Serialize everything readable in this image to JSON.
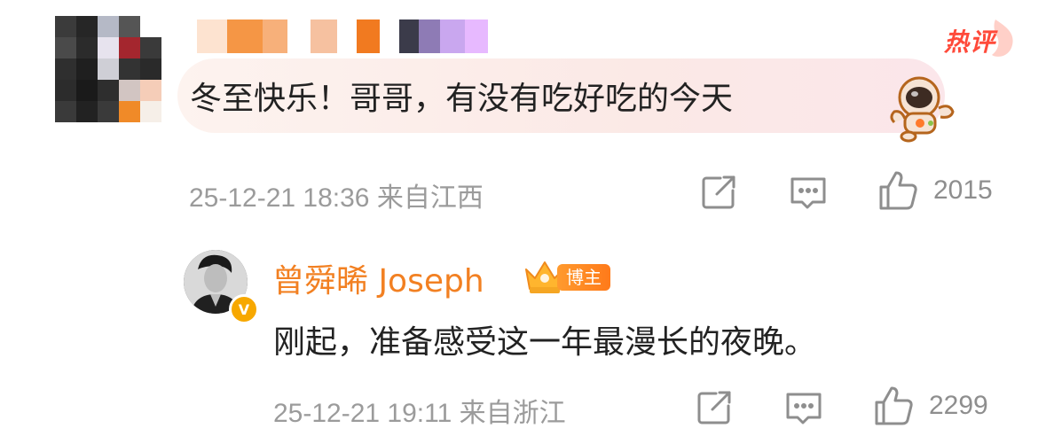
{
  "comment": {
    "hot_label": "热评",
    "text": "冬至快乐！哥哥，有没有吃好吃的今天",
    "timestamp": "25-12-21 18:36",
    "location": "来自江西",
    "like_count": "2015"
  },
  "reply": {
    "author": "曾舜晞 Joseph",
    "author_tag": "博主",
    "verified_mark": "V",
    "text": "刚起，准备感受这一年最漫长的夜晚。",
    "timestamp": "25-12-21 19:11",
    "location": "来自浙江",
    "like_count": "2299"
  },
  "colors": {
    "accent_orange": "#f28022",
    "hot_red": "#ff4a3a",
    "meta_gray": "#9b9b9b"
  },
  "icons": [
    "repost-icon",
    "comment-icon",
    "like-icon",
    "hot-comment-badge",
    "astronaut-sticker",
    "crown-icon"
  ]
}
